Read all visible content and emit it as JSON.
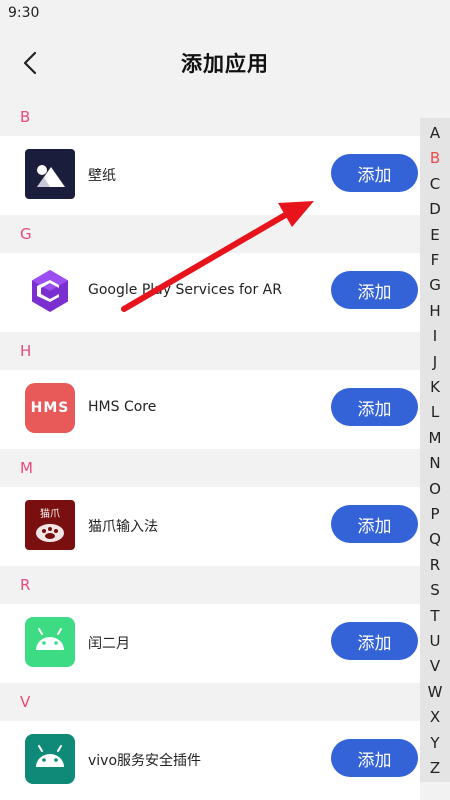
{
  "status_bar": {
    "time": "9:30"
  },
  "header": {
    "title": "添加应用"
  },
  "add_label": "添加",
  "sections": [
    {
      "letter": "B",
      "apps": [
        {
          "name": "壁纸",
          "icon": "wallpaper-icon"
        }
      ]
    },
    {
      "letter": "G",
      "apps": [
        {
          "name": "Google Play Services for AR",
          "icon": "google-ar-icon"
        }
      ]
    },
    {
      "letter": "H",
      "apps": [
        {
          "name": "HMS Core",
          "icon": "hms-core-icon",
          "icon_text": "HMS"
        }
      ]
    },
    {
      "letter": "M",
      "apps": [
        {
          "name": "猫爪输入法",
          "icon": "maozhua-icon",
          "icon_text": "猫爪"
        }
      ]
    },
    {
      "letter": "R",
      "apps": [
        {
          "name": "闰二月",
          "icon": "android-icon"
        }
      ]
    },
    {
      "letter": "V",
      "apps": [
        {
          "name": "vivo服务安全插件",
          "icon": "android-icon"
        }
      ]
    }
  ],
  "index_letters": [
    "A",
    "B",
    "C",
    "D",
    "E",
    "F",
    "G",
    "H",
    "I",
    "J",
    "K",
    "L",
    "M",
    "N",
    "O",
    "P",
    "Q",
    "R",
    "S",
    "T",
    "U",
    "V",
    "W",
    "X",
    "Y",
    "Z"
  ],
  "index_active": "B",
  "colors": {
    "accent": "#3463d8",
    "section_letter": "#e94b7a",
    "index_active": "#e94b4b",
    "annotation_arrow": "#e8141b"
  }
}
